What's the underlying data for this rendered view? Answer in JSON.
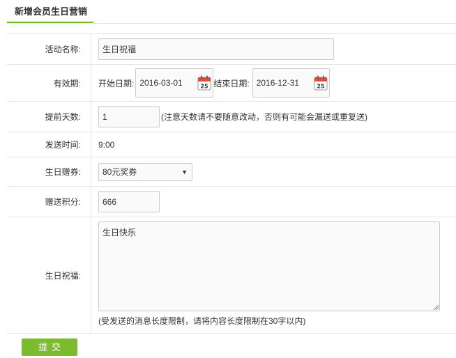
{
  "tab": {
    "title": "新增会员生日营销"
  },
  "form": {
    "activity_name": {
      "label": "活动名称:",
      "value": "生日祝福"
    },
    "validity": {
      "label": "有效期:",
      "start_label": "开始日期:",
      "start_value": "2016-03-01",
      "end_label": "结束日期:",
      "end_value": "2016-12-31",
      "calendar_day": "25"
    },
    "advance_days": {
      "label": "提前天数:",
      "value": "1",
      "hint": "(注意天数请不要随意改动，否则有可能会漏送或重复送)"
    },
    "send_time": {
      "label": "发送时间:",
      "value": "9:00"
    },
    "coupon": {
      "label": "生日赠券:",
      "selected": "80元奖券",
      "arrow": "▼"
    },
    "points": {
      "label": "赠送积分:",
      "value": "666"
    },
    "greeting": {
      "label": "生日祝福:",
      "value": "生日快乐",
      "hint": "(受发送的消息长度限制，请将内容长度限制在30字以内)"
    }
  },
  "submit": {
    "label": "提交"
  },
  "colors": {
    "accent": "#7cbc2c",
    "calendar_red": "#e34a3c"
  }
}
